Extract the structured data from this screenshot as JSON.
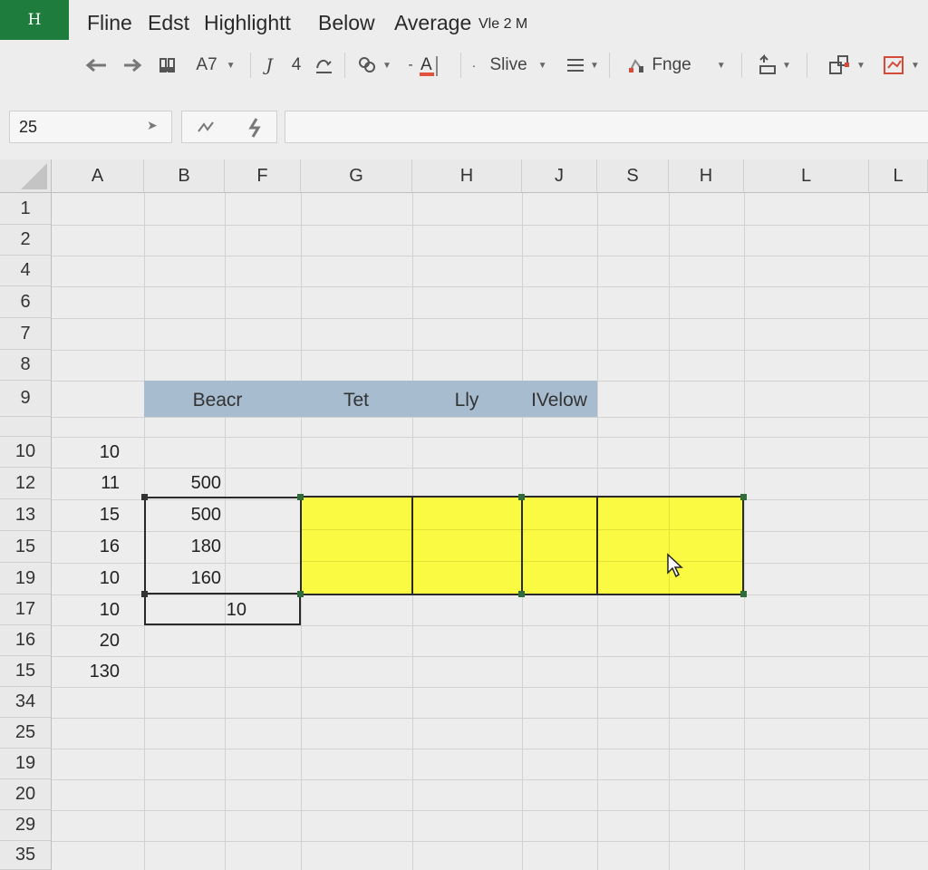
{
  "app": {
    "logo_letter": "H"
  },
  "menu": {
    "items": [
      "Fline",
      "Edst",
      "Highlightt",
      "Below",
      "Average"
    ],
    "extra": "Vle 2 M"
  },
  "toolbar": {
    "font_size": "A7",
    "item_4": "4",
    "slide_label": "Slive",
    "range_label": "Fnge",
    "icons": [
      "undo-icon",
      "redo-icon",
      "format-painter-icon",
      "font-size-dropdown",
      "italic-icon",
      "underline-icon",
      "text-effects-icon",
      "font-color-icon",
      "align-icon",
      "chart-icon",
      "sort-icon",
      "shapes-icon",
      "layout-icon"
    ]
  },
  "formula_bar": {
    "name_box": "25",
    "formula": ""
  },
  "columns": [
    "A",
    "B",
    "F",
    "G",
    "H",
    "J",
    "S",
    "H",
    "L",
    "L"
  ],
  "rows": [
    "1",
    "2",
    "4",
    "6",
    "7",
    "8",
    "9",
    "",
    "10",
    "12",
    "13",
    "15",
    "19",
    "17",
    "16",
    "15",
    "34",
    "25",
    "19",
    "20",
    "29",
    "35"
  ],
  "band_headers": [
    "Beacr",
    "Tet",
    "Lly",
    "IVelow"
  ],
  "col_a_values": {
    "10": "10",
    "12": "11",
    "13": "15",
    "15": "16",
    "19": "10",
    "17": "10",
    "16": "20",
    "15b": "130"
  },
  "col_a_list": [
    "10",
    "11",
    "15",
    "16",
    "10",
    "10",
    "20",
    "130"
  ],
  "col_b_list": [
    "500",
    "500",
    "180",
    "160",
    "10"
  ],
  "colors": {
    "highlight": "#fafa43",
    "header_band": "#a8bccf",
    "logo": "#1e7d3c",
    "handle": "#2f6b3b"
  }
}
